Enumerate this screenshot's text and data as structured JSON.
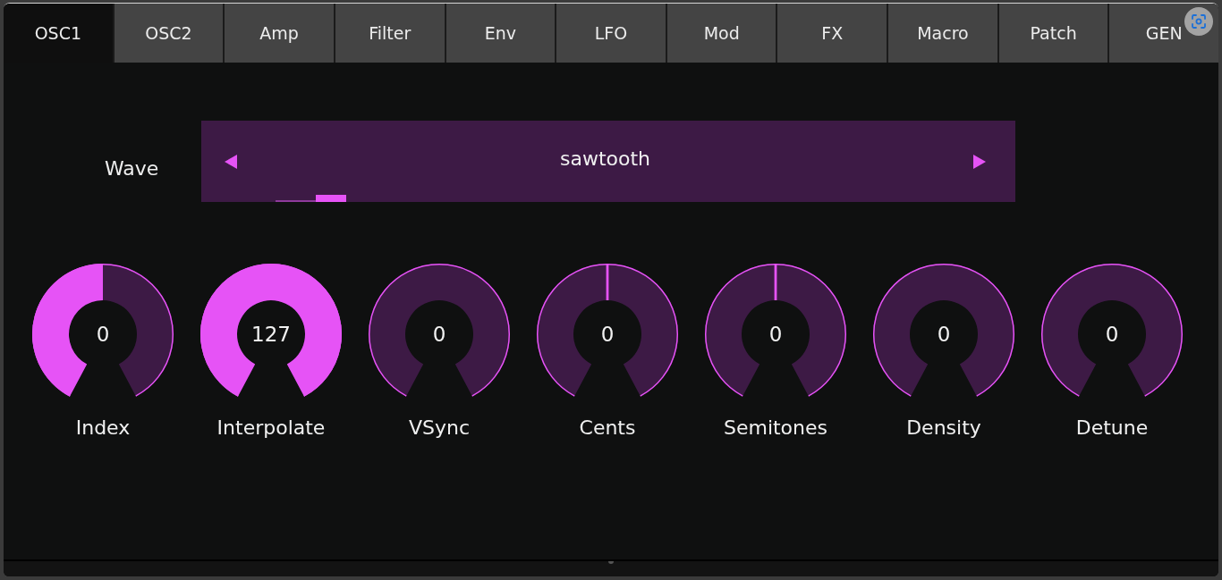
{
  "tabs": [
    {
      "label": "OSC1",
      "selected": true
    },
    {
      "label": "OSC2",
      "selected": false
    },
    {
      "label": "Amp",
      "selected": false
    },
    {
      "label": "Filter",
      "selected": false
    },
    {
      "label": "Env",
      "selected": false
    },
    {
      "label": "LFO",
      "selected": false
    },
    {
      "label": "Mod",
      "selected": false
    },
    {
      "label": "FX",
      "selected": false
    },
    {
      "label": "Macro",
      "selected": false
    },
    {
      "label": "Patch",
      "selected": false
    },
    {
      "label": "GEN",
      "selected": false
    }
  ],
  "wave": {
    "label": "Wave",
    "value": "sawtooth"
  },
  "knobs": [
    {
      "label": "Index",
      "value": "0",
      "kind": "unipolar",
      "level": 0.5
    },
    {
      "label": "Interpolate",
      "value": "127",
      "kind": "unipolar",
      "level": 1
    },
    {
      "label": "VSync",
      "value": "0",
      "kind": "unipolar"
    },
    {
      "label": "Cents",
      "value": "0",
      "kind": "bipolar",
      "level": 0.5
    },
    {
      "label": "Semitones",
      "value": "0",
      "kind": "bipolar",
      "level": 0.5
    },
    {
      "label": "Density",
      "value": "0",
      "kind": "unipolar"
    },
    {
      "label": "Detune",
      "value": "0",
      "kind": "unipolar"
    }
  ]
}
